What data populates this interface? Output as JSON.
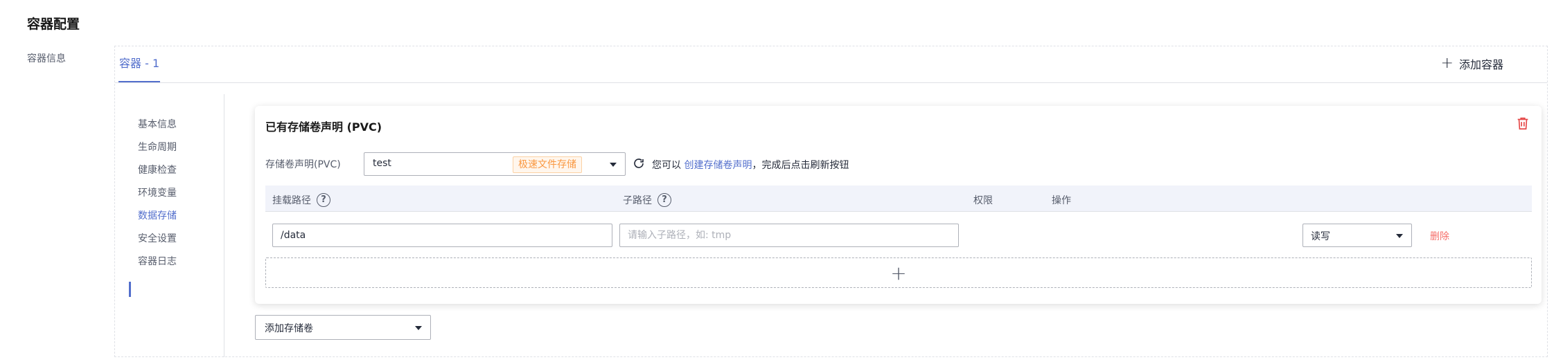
{
  "section": {
    "title": "容器配置",
    "side_label": "容器信息"
  },
  "tabs": {
    "active": "容器 - 1",
    "add_label": "添加容器"
  },
  "nav": {
    "items": [
      "基本信息",
      "生命周期",
      "健康检查",
      "环境变量",
      "数据存储",
      "安全设置",
      "容器日志"
    ],
    "active_index": 4
  },
  "card": {
    "title": "已有存储卷声明 (PVC)",
    "pvc_label": "存储卷声明(PVC)",
    "pvc_value": "test",
    "pvc_tag": "极速文件存储",
    "hint_prefix": "您可以",
    "hint_link": "创建存储卷声明",
    "hint_suffix": "，完成后点击刷新按钮",
    "columns": {
      "mount_path": "挂载路径",
      "sub_path": "子路径",
      "permission": "权限",
      "action": "操作"
    },
    "row": {
      "mount_path": "/data",
      "sub_path_placeholder": "请输入子路径，如: tmp",
      "permission": "读写",
      "delete": "删除"
    }
  },
  "add_volume": {
    "label": "添加存储卷"
  },
  "colors": {
    "accent": "#526ecc",
    "danger": "#f66f6a",
    "tag_orange": "#fa9841"
  }
}
